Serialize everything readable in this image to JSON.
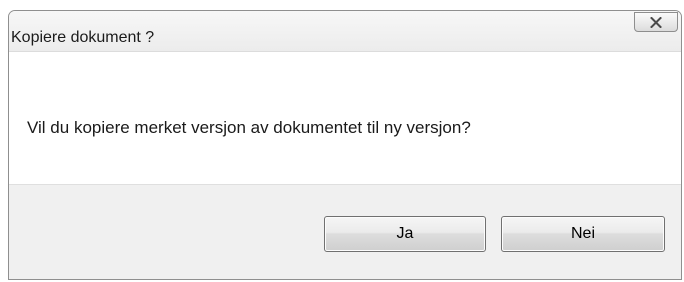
{
  "dialog": {
    "title": "Kopiere dokument ?",
    "message": "Vil du kopiere merket versjon av dokumentet til ny versjon?",
    "buttons": {
      "yes_label": "Ja",
      "no_label": "Nei"
    },
    "icons": {
      "close": "close-icon"
    }
  }
}
